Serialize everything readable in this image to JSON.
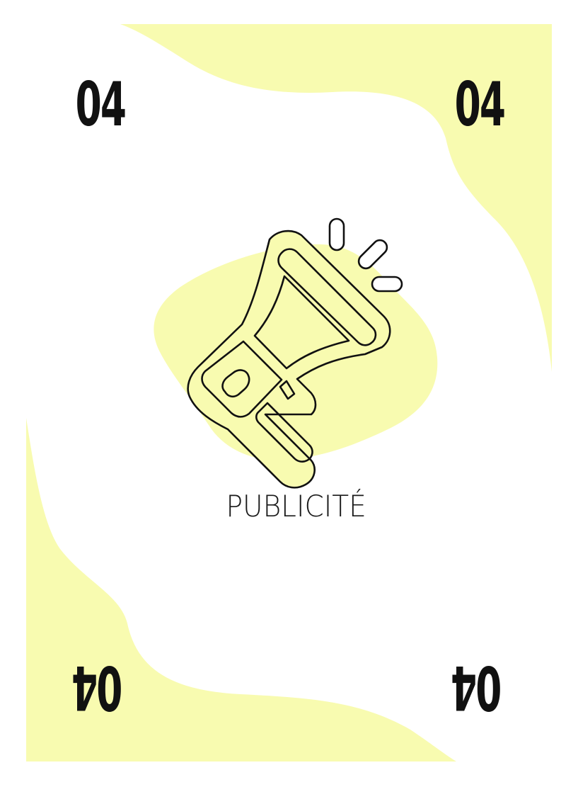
{
  "card": {
    "number": "04",
    "label": "PUBLICITÉ",
    "icon": "megaphone-icon"
  },
  "colors": {
    "accent": "#f8fbb0",
    "stroke": "#111111",
    "background": "#ffffff"
  }
}
